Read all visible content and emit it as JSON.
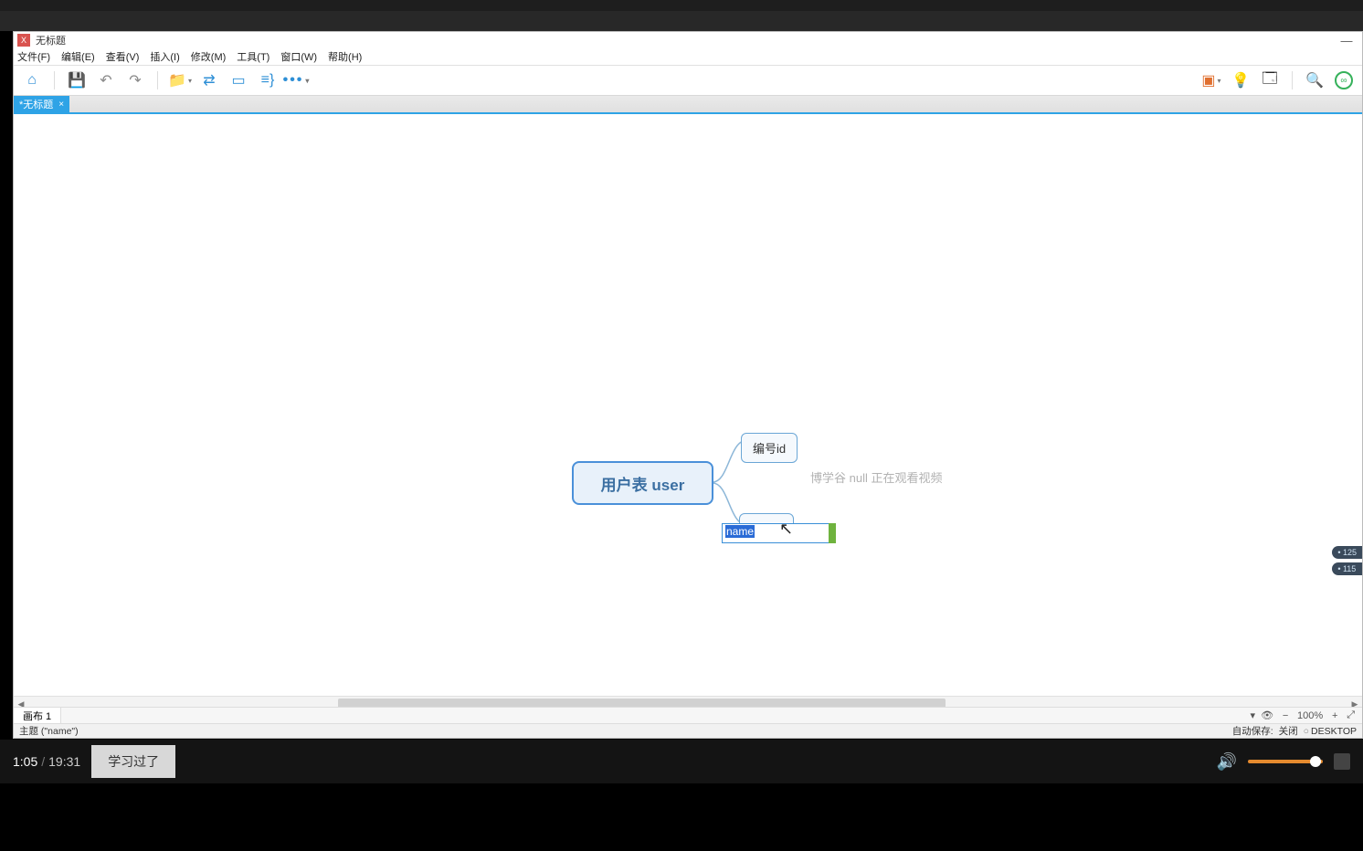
{
  "window": {
    "title": "无标题",
    "minimize": "—"
  },
  "menu": {
    "file": "文件(F)",
    "edit": "编辑(E)",
    "view": "查看(V)",
    "insert": "插入(I)",
    "modify": "修改(M)",
    "tools": "工具(T)",
    "window": "窗口(W)",
    "help": "帮助(H)"
  },
  "doctab": {
    "label": "*无标题",
    "close": "×"
  },
  "mindmap": {
    "central": "用户表 user",
    "child_id": "编号id",
    "editing_value": "name"
  },
  "watermark": "博学谷 null 正在观看视频",
  "sheet": {
    "label": "画布 1"
  },
  "zoom": {
    "minus": "−",
    "value": "100%",
    "plus": "+"
  },
  "status": {
    "left": "主题 (\"name\")",
    "autosave_label": "自动保存:",
    "autosave_state": "关闭",
    "desktop": "DESKTOP"
  },
  "video": {
    "current": "1:05",
    "total": "19:31",
    "learned_btn": "学习过了"
  },
  "floattips": {
    "a": "125",
    "b": "115"
  }
}
